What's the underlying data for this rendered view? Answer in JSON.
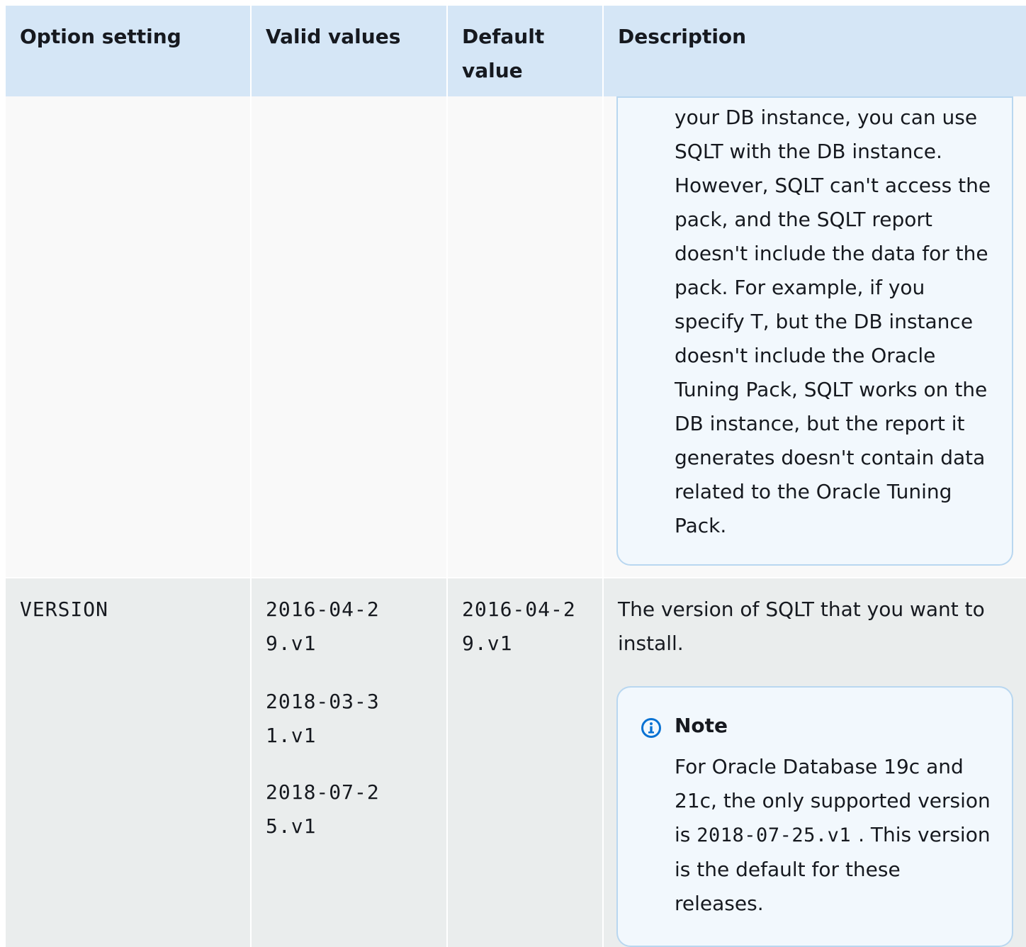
{
  "table": {
    "headers": [
      "Option setting",
      "Valid values",
      "Default value",
      "Description"
    ],
    "row1": {
      "description_note_text": "your DB instance, you can use SQLT with the DB instance. However, SQLT can't access the pack, and the SQLT report doesn't include the data for the pack. For example, if you specify T, but the DB instance doesn't include the Oracle Tuning Pack, SQLT works on the DB instance, but the report it generates doesn't contain data related to the Oracle Tuning Pack."
    },
    "row2": {
      "option": "VERSION",
      "valid_values": [
        "2016-04-29.v1",
        "2018-03-31.v1",
        "2018-07-25.v1"
      ],
      "default_value": "2016-04-29.v1",
      "description": "The version of SQLT that you want to install.",
      "note": {
        "title": "Note",
        "text_before": "For Oracle Database 19c and 21c, the only supported version is ",
        "code": "2018-07-25.v1",
        "text_after": ". This version is the default for these releases."
      }
    }
  },
  "colors": {
    "header_bg": "#d5e6f6",
    "row1_bg": "#f9f9f9",
    "row2_bg": "#eaeded",
    "note_bg": "#f2f8fd",
    "note_border": "#b9d7f0",
    "info_icon": "#0972d3"
  },
  "icons": {
    "note_icon": "info-icon"
  }
}
